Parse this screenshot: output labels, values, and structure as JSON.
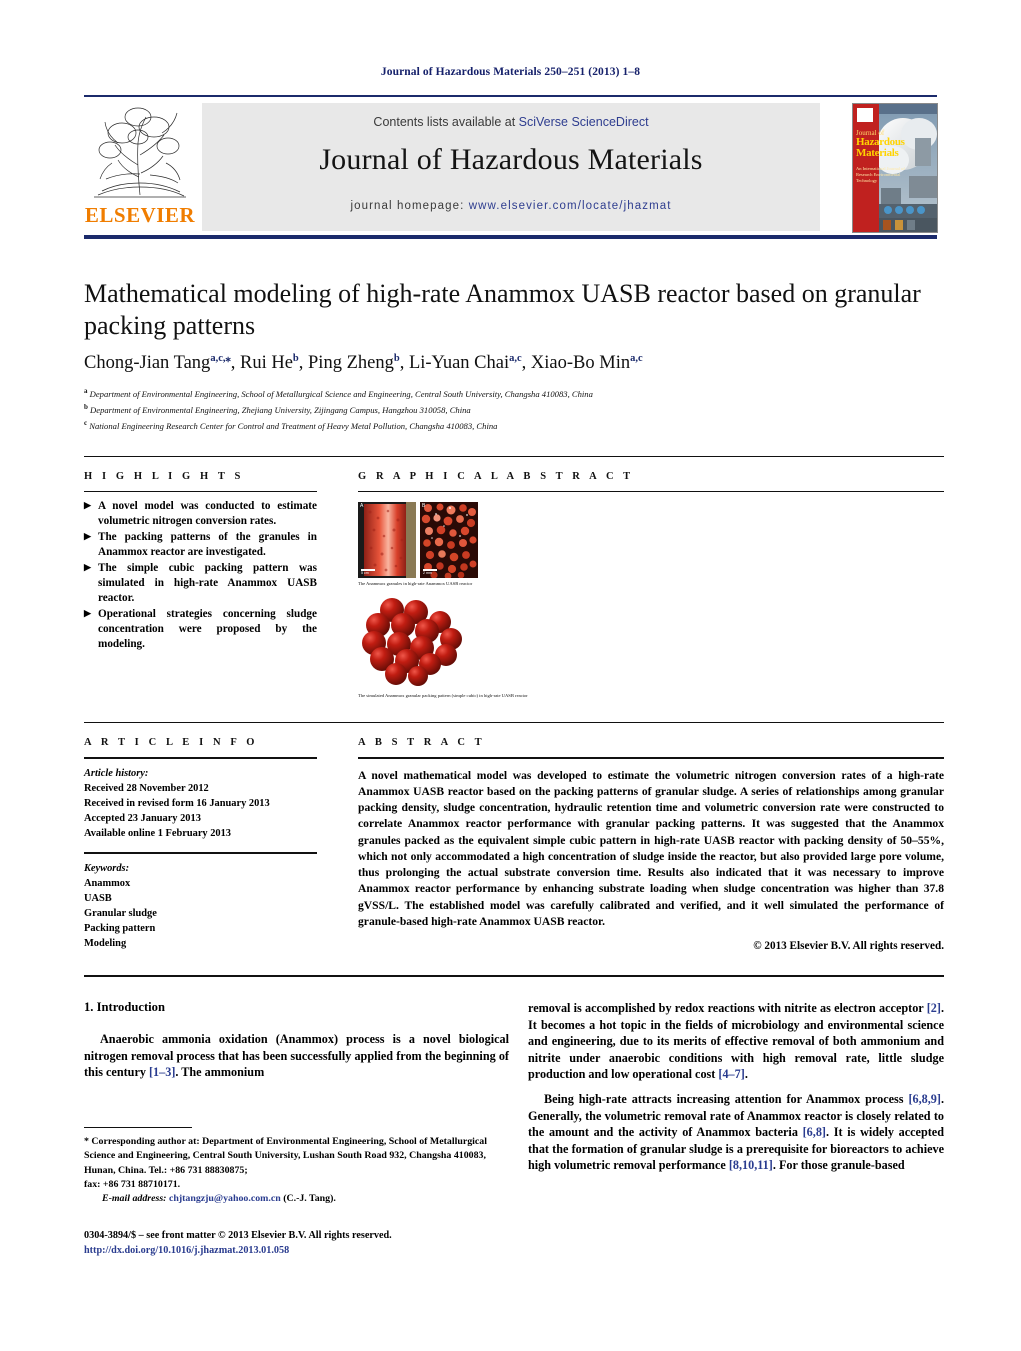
{
  "runhead": "Journal of Hazardous Materials 250–251 (2013) 1–8",
  "masthead": {
    "contents_prefix": "Contents lists available at ",
    "contents_link": "SciVerse ScienceDirect",
    "journal_name": "Journal of Hazardous Materials",
    "homepage_prefix": "journal homepage: ",
    "homepage_url": "www.elsevier.com/locate/jhazmat",
    "publisher": "ELSEVIER",
    "cover": {
      "title_small": "Journal of",
      "title_big1": "Hazardous",
      "title_big2": "Materials",
      "subtitle": "An International Journal of Research\nEnvironmental Technology"
    }
  },
  "article": {
    "title": "Mathematical modeling of high-rate Anammox UASB reactor based on granular packing patterns",
    "authors": [
      {
        "name": "Chong-Jian Tang",
        "sup": "a,c,⁎"
      },
      {
        "name": "Rui He",
        "sup": "b"
      },
      {
        "name": "Ping Zheng",
        "sup": "b"
      },
      {
        "name": "Li-Yuan Chai",
        "sup": "a,c"
      },
      {
        "name": "Xiao-Bo Min",
        "sup": "a,c"
      }
    ],
    "affiliations": [
      {
        "mark": "a",
        "text": "Department of Environmental Engineering, School of Metallurgical Science and Engineering, Central South University, Changsha 410083, China"
      },
      {
        "mark": "b",
        "text": "Department of Environmental Engineering, Zhejiang University, Zijingang Campus, Hangzhou 310058, China"
      },
      {
        "mark": "c",
        "text": "National Engineering Research Center for Control and Treatment of Heavy Metal Pollution, Changsha 410083, China"
      }
    ]
  },
  "highlights": {
    "heading": "H I G H L I G H T S",
    "bullet_glyph": "▶",
    "items": [
      "A novel model was conducted to estimate volumetric nitrogen conversion rates.",
      "The packing patterns of the granules in Anammox reactor are investigated.",
      "The simple cubic packing pattern was simulated in high-rate Anammox UASB reactor.",
      "Operational strategies concerning sludge concentration were proposed by the modeling."
    ]
  },
  "graphical_abstract": {
    "heading": "G R A P H I C A L   A B S T R A C T",
    "figure1": {
      "panel_a_label": "A",
      "panel_b_label": "B",
      "scale_a": "5 cm",
      "scale_b": "2 mm",
      "caption": "The Anammox granules in high-rate Anammox UASB reactor"
    },
    "figure2": {
      "caption": "The simulated Anammox granular packing pattern (simple cubic) in high-rate UASB reactor"
    }
  },
  "article_info": {
    "heading": "A R T I C L E   I N F O",
    "history_label": "Article history:",
    "history": [
      "Received 28 November 2012",
      "Received in revised form 16 January 2013",
      "Accepted 23 January 2013",
      "Available online 1 February 2013"
    ],
    "keywords_label": "Keywords:",
    "keywords": [
      "Anammox",
      "UASB",
      "Granular sludge",
      "Packing pattern",
      "Modeling"
    ]
  },
  "abstract": {
    "heading": "A B S T R A C T",
    "text": "A novel mathematical model was developed to estimate the volumetric nitrogen conversion rates of a high-rate Anammox UASB reactor based on the packing patterns of granular sludge. A series of relationships among granular packing density, sludge concentration, hydraulic retention time and volumetric conversion rate were constructed to correlate Anammox reactor performance with granular packing patterns. It was suggested that the Anammox granules packed as the equivalent simple cubic pattern in high-rate UASB reactor with packing density of 50–55%, which not only accommodated a high concentration of sludge inside the reactor, but also provided large pore volume, thus prolonging the actual substrate conversion time. Results also indicated that it was necessary to improve Anammox reactor performance by enhancing substrate loading when sludge concentration was higher than 37.8 gVSS/L. The established model was carefully calibrated and verified, and it well simulated the performance of granule-based high-rate Anammox UASB reactor.",
    "copyright": "© 2013 Elsevier B.V. All rights reserved."
  },
  "body": {
    "section_heading": "1.  Introduction",
    "left_paragraphs": [
      "Anaerobic ammonia oxidation (Anammox) process is a novel biological nitrogen removal process that has been successfully applied from the beginning of this century [1–3]. The ammonium"
    ],
    "right_paragraphs": [
      "removal is accomplished by redox reactions with nitrite as electron acceptor [2]. It becomes a hot topic in the fields of microbiology and environmental science and engineering, due to its merits of effective removal of both ammonium and nitrite under anaerobic conditions with high removal rate, little sludge production and low operational cost [4–7].",
      "Being high-rate attracts increasing attention for Anammox process [6,8,9]. Generally, the volumetric removal rate of Anammox reactor is closely related to the amount and the activity of Anammox bacteria [6,8]. It is widely accepted that the formation of granular sludge is a prerequisite for bioreactors to achieve high volumetric removal performance [8,10,11]. For those granule-based"
    ]
  },
  "footnote": {
    "corresponding": "* Corresponding author at: Department of Environmental Engineering, School of Metallurgical Science and Engineering, Central South University, Lushan South Road 932, Changsha 410083, Hunan, China. Tel.: +86 731 88830875;",
    "fax": "fax: +86 731 88710171.",
    "email_label": "E-mail address:",
    "email": "chjtangzju@yahoo.com.cn",
    "email_suffix": "(C.-J. Tang)."
  },
  "imprint": {
    "line1": "0304-3894/$ – see front matter © 2013 Elsevier B.V. All rights reserved.",
    "doi": "http://dx.doi.org/10.1016/j.jhazmat.2013.01.058"
  },
  "colors": {
    "link": "#2a3c8f",
    "rule": "#1b2a6b",
    "elsevier_orange": "#f07d00",
    "band": "#e8e8e8",
    "granule_red": "#b01a13"
  }
}
